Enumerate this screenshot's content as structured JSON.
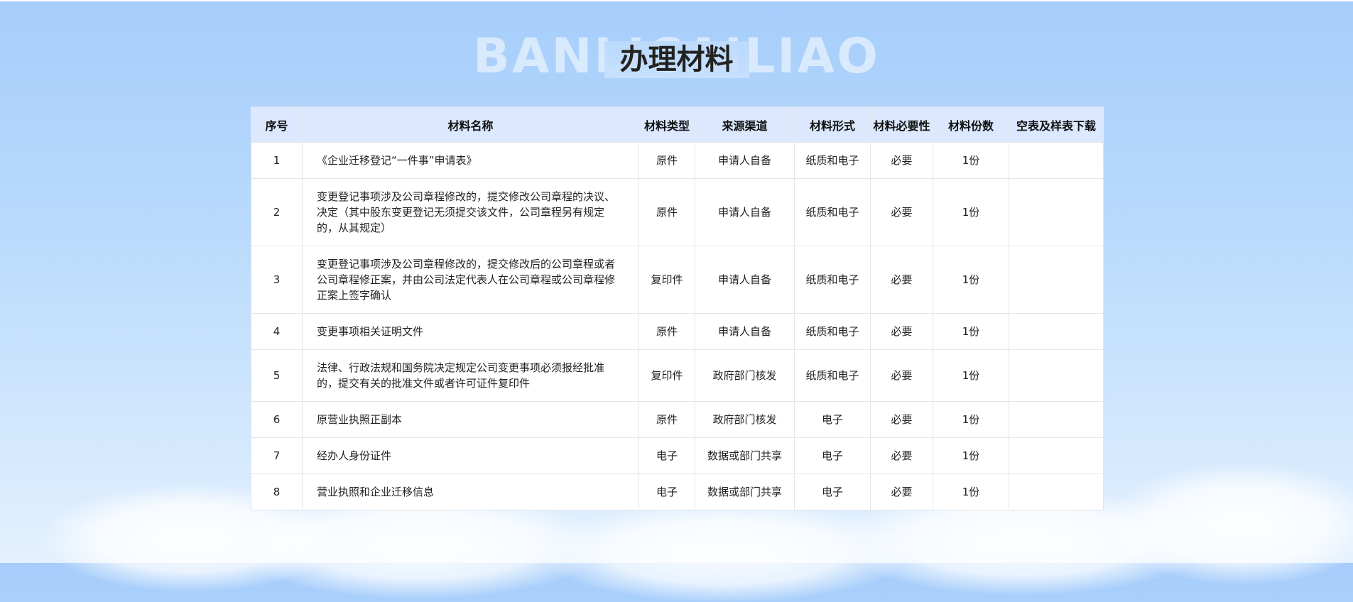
{
  "background_word": "BANLICAILIAO",
  "title": "办理材料",
  "table": {
    "headers": [
      "序号",
      "材料名称",
      "材料类型",
      "来源渠道",
      "材料形式",
      "材料必要性",
      "材料份数",
      "空表及样表下载"
    ],
    "rows": [
      {
        "no": "1",
        "name": "《企业迁移登记“一件事”申请表》",
        "type": "原件",
        "source": "申请人自备",
        "form": "纸质和电子",
        "required": "必要",
        "copies": "1份",
        "download": ""
      },
      {
        "no": "2",
        "name": "变更登记事项涉及公司章程修改的，提交修改公司章程的决议、决定（其中股东变更登记无须提交该文件，公司章程另有规定的，从其规定）",
        "type": "原件",
        "source": "申请人自备",
        "form": "纸质和电子",
        "required": "必要",
        "copies": "1份",
        "download": ""
      },
      {
        "no": "3",
        "name": "变更登记事项涉及公司章程修改的，提交修改后的公司章程或者公司章程修正案，并由公司法定代表人在公司章程或公司章程修正案上签字确认",
        "type": "复印件",
        "source": "申请人自备",
        "form": "纸质和电子",
        "required": "必要",
        "copies": "1份",
        "download": ""
      },
      {
        "no": "4",
        "name": "变更事项相关证明文件",
        "type": "原件",
        "source": "申请人自备",
        "form": "纸质和电子",
        "required": "必要",
        "copies": "1份",
        "download": ""
      },
      {
        "no": "5",
        "name": "法律、行政法规和国务院决定规定公司变更事项必须报经批准的，提交有关的批准文件或者许可证件复印件",
        "type": "复印件",
        "source": "政府部门核发",
        "form": "纸质和电子",
        "required": "必要",
        "copies": "1份",
        "download": ""
      },
      {
        "no": "6",
        "name": "原营业执照正副本",
        "type": "原件",
        "source": "政府部门核发",
        "form": "电子",
        "required": "必要",
        "copies": "1份",
        "download": ""
      },
      {
        "no": "7",
        "name": "经办人身份证件",
        "type": "电子",
        "source": "数据或部门共享",
        "form": "电子",
        "required": "必要",
        "copies": "1份",
        "download": ""
      },
      {
        "no": "8",
        "name": "营业执照和企业迁移信息",
        "type": "电子",
        "source": "数据或部门共享",
        "form": "电子",
        "required": "必要",
        "copies": "1份",
        "download": ""
      }
    ]
  },
  "colors": {
    "sky_top": "#a6cdfb",
    "sky_bottom": "#e4f1fe",
    "header_bg": "#dbe8fd",
    "border": "#e3e6ea"
  }
}
